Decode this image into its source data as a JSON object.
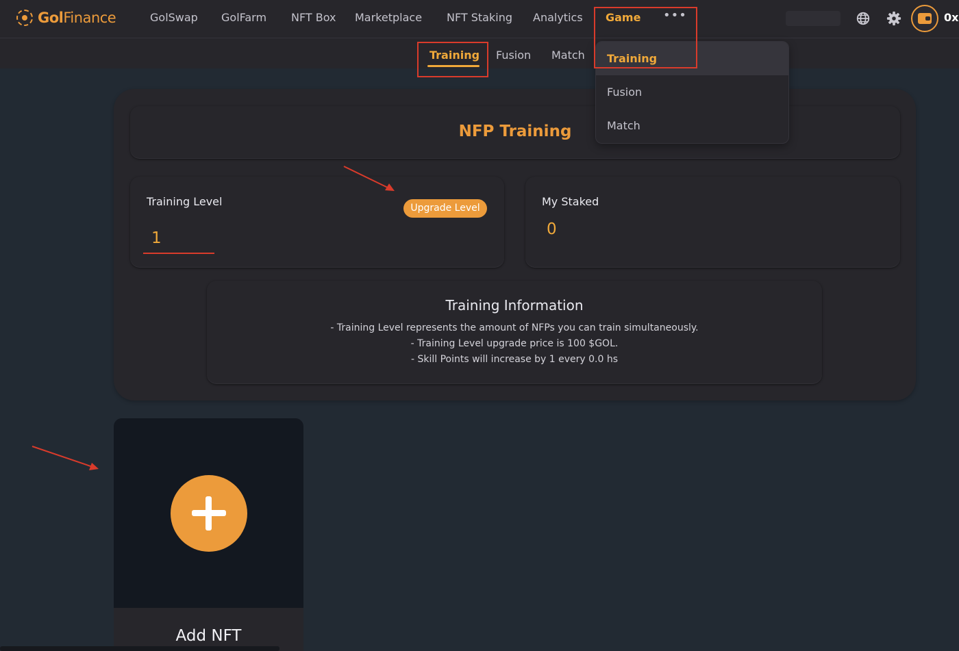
{
  "app": {
    "brand_bold": "Gol",
    "brand_light": "Finance",
    "wallet_address": "0x"
  },
  "nav": {
    "items": [
      "GolSwap",
      "GolFarm",
      "NFT Box",
      "Marketplace",
      "NFT Staking",
      "Analytics",
      "Game"
    ],
    "active": "Game",
    "more_label": "•••"
  },
  "subnav": {
    "items": [
      "Training",
      "Fusion",
      "Match"
    ],
    "active": "Training"
  },
  "dropdown": {
    "items": [
      "Training",
      "Fusion",
      "Match"
    ],
    "active": "Training"
  },
  "training": {
    "title": "NFP Training",
    "level_label": "Training Level",
    "level_value": "1",
    "upgrade_button": "Upgrade Level",
    "staked_label": "My Staked",
    "staked_value": "0",
    "info_title": "Training Information",
    "info_lines": [
      "- Training Level represents the amount of NFPs you can train simultaneously.",
      "- Training Level upgrade price is 100 $GOL.",
      "- Skill Points will increase by 1 every 0.0 hs"
    ]
  },
  "add_nft": {
    "label": "Add NFT"
  },
  "colors": {
    "accent": "#ec9b3b",
    "annotation": "#d93b2b",
    "background": "#222a33",
    "panel": "#27262b"
  },
  "icons": [
    "logo-icon",
    "more-icon",
    "globe-icon",
    "gear-icon",
    "wallet-icon",
    "plus-icon"
  ]
}
